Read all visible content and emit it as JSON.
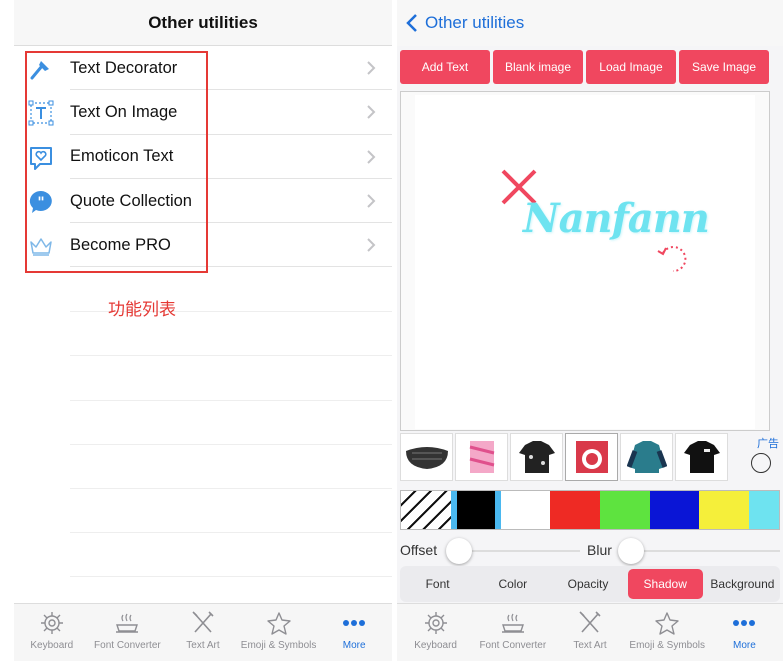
{
  "left": {
    "title": "Other utilities",
    "items": [
      {
        "label": "Text Decorator",
        "icon": "brush-icon"
      },
      {
        "label": "Text On Image",
        "icon": "text-frame-icon"
      },
      {
        "label": "Emoticon Text",
        "icon": "heart-bubble-icon"
      },
      {
        "label": "Quote Collection",
        "icon": "quote-bubble-icon"
      },
      {
        "label": "Become PRO",
        "icon": "crown-icon"
      }
    ],
    "annotation": "功能列表",
    "annotation_color": "#e53935"
  },
  "tabs": [
    {
      "label": "Keyboard",
      "icon": "gear-icon"
    },
    {
      "label": "Font Converter",
      "icon": "pot-icon"
    },
    {
      "label": "Text Art",
      "icon": "pencil-cross-icon"
    },
    {
      "label": "Emoji & Symbols",
      "icon": "star-icon"
    },
    {
      "label": "More",
      "icon": "more-dots-icon",
      "active": true
    }
  ],
  "right": {
    "back_label": "Other utilities",
    "buttons": [
      "Add Text",
      "Blank image",
      "Load Image",
      "Save Image"
    ],
    "canvas_text": "Nanfann",
    "ad_label": "广告",
    "swatches": [
      "#ffffff",
      "#000000",
      "#ffffff",
      "#ee2a24",
      "#5ee33f",
      "#0a15d6",
      "#f5ef3a",
      "#6ee3f0"
    ],
    "sliders": {
      "offset_label": "Offset",
      "blur_label": "Blur"
    },
    "segments": [
      "Font",
      "Color",
      "Opacity",
      "Shadow",
      "Background"
    ],
    "selected_segment": "Shadow"
  },
  "colors": {
    "accent": "#f0475f",
    "link": "#1e6fd9",
    "text_color": "#6ee3f0"
  }
}
